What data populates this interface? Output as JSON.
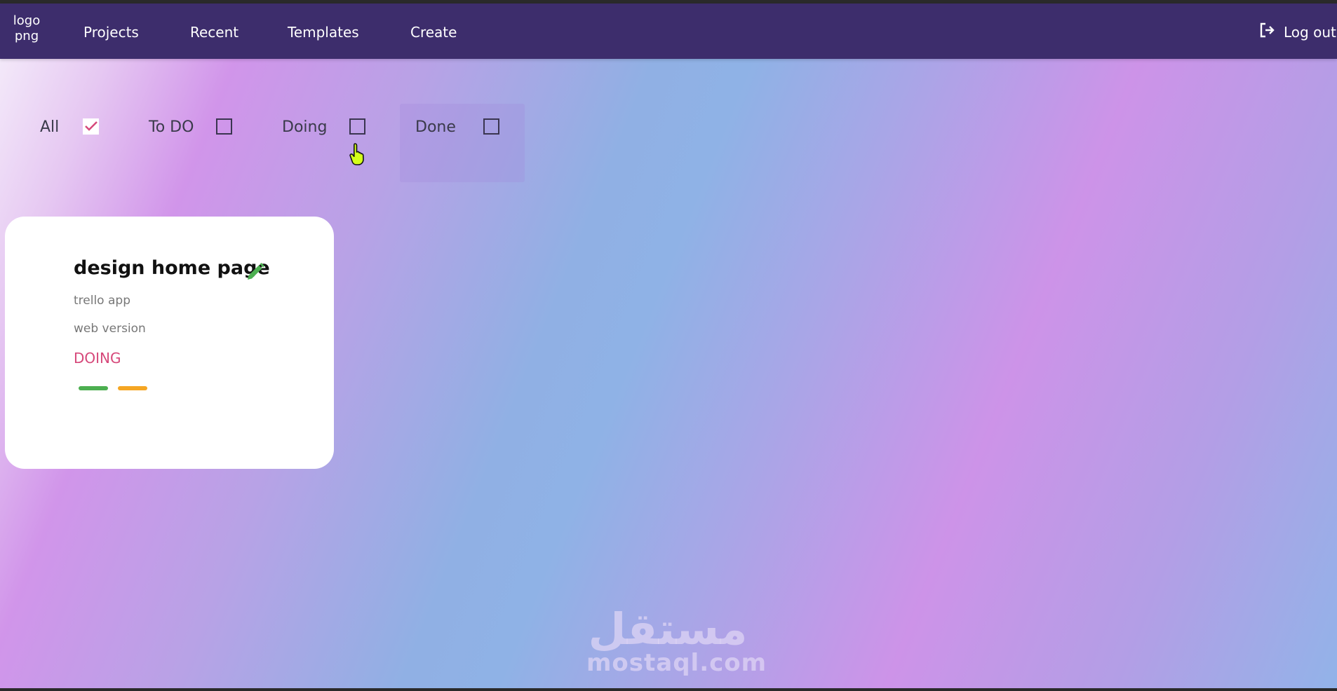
{
  "nav": {
    "logo": "logo\npng",
    "links": [
      "Projects",
      "Recent",
      "Templates",
      "Create"
    ],
    "logout": "Log out"
  },
  "filters": [
    {
      "label": "All",
      "checked": true
    },
    {
      "label": "To DO",
      "checked": false
    },
    {
      "label": "Doing",
      "checked": false
    },
    {
      "label": "Done",
      "checked": false
    }
  ],
  "card": {
    "title": "design home page",
    "line1": "trello app",
    "line2": "web version",
    "status": "DOING",
    "tags": [
      "#4caf50",
      "#f5a623"
    ]
  },
  "colors": {
    "navbar": "#3d2d6c",
    "status": "#d6487a",
    "edit_icon": "#4caf50",
    "check": "#d6487a"
  },
  "icons": {
    "logout": "logout-icon",
    "edit": "pencil-icon",
    "check": "checkmark-icon",
    "cursor": "hand-pointer-icon"
  },
  "watermark": {
    "arabic": "مستقل",
    "latin": "mostaql.com"
  }
}
